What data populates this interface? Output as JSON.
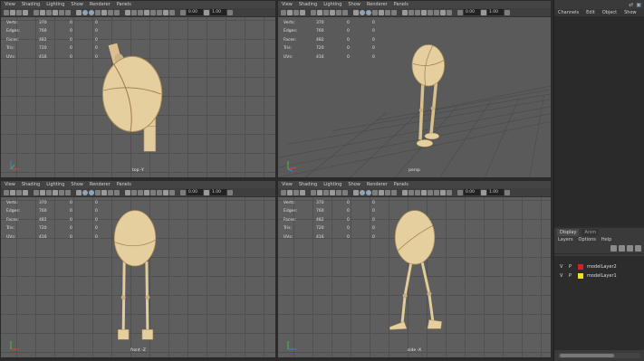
{
  "viewport_menu": [
    "View",
    "Shading",
    "Lighting",
    "Show",
    "Renderer",
    "Panels"
  ],
  "toolbar": {
    "near_clip": "0.00",
    "far_clip": "1.00"
  },
  "hud": {
    "labels": [
      "Verts:",
      "Edges:",
      "Faces:",
      "Tris:",
      "UVs:"
    ],
    "values": [
      [
        "370",
        "0",
        "0"
      ],
      [
        "760",
        "0",
        "0"
      ],
      [
        "482",
        "0",
        "0"
      ],
      [
        "720",
        "0",
        "0"
      ],
      [
        "416",
        "0",
        "0"
      ]
    ]
  },
  "viewports": {
    "top": "top -Y",
    "persp": "persp",
    "front": "front -Z",
    "side": "side -X"
  },
  "channel_box": {
    "menu": [
      "Channels",
      "Edit",
      "Object",
      "Show"
    ]
  },
  "layer_editor": {
    "tabs": [
      "Display",
      "Anim"
    ],
    "menu": [
      "Layers",
      "Options",
      "Help"
    ],
    "layers": [
      {
        "v": "V",
        "p": "P",
        "color": "#d42020",
        "name": "modelLayer2"
      },
      {
        "v": "V",
        "p": "P",
        "color": "#f0e020",
        "name": "modelLayer1"
      }
    ]
  },
  "colors": {
    "body": "#e6cf9e",
    "body_shadow": "#b89a66",
    "grid": "#5e5e5e"
  }
}
